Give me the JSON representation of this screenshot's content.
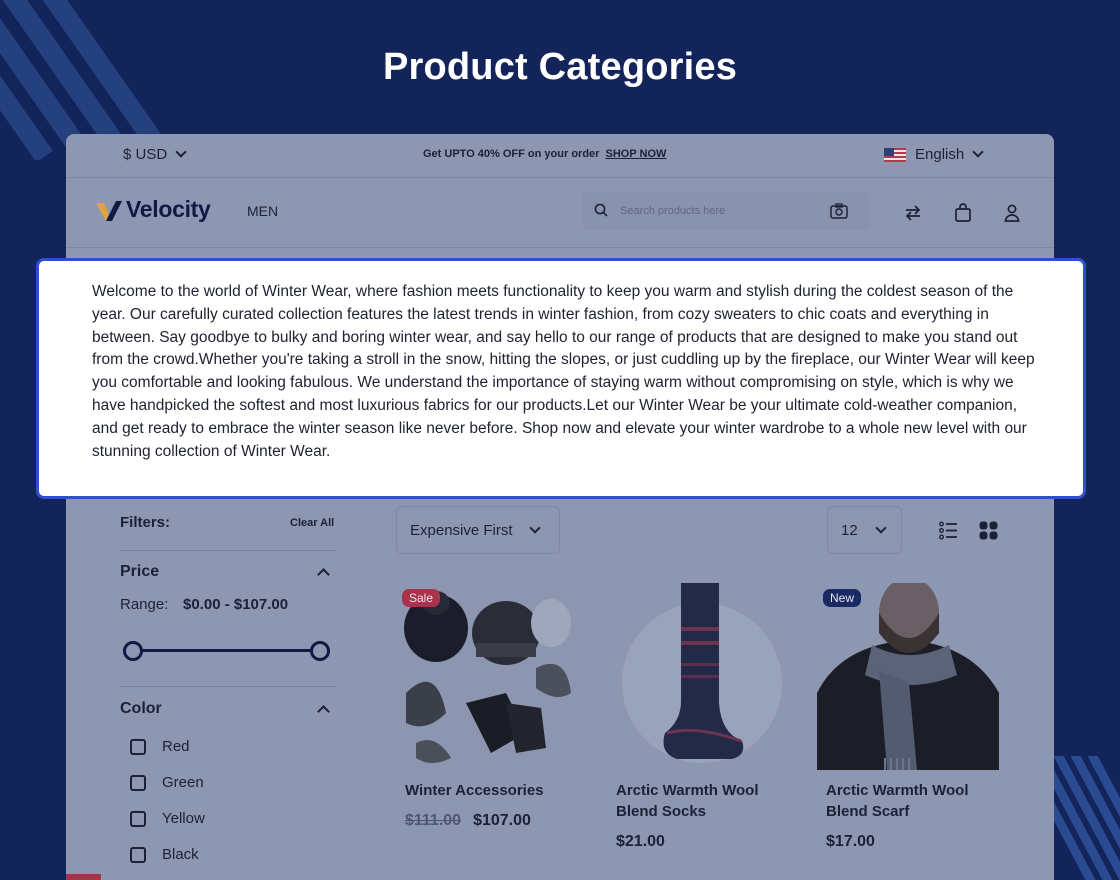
{
  "page_title": "Product Categories",
  "topbar": {
    "currency": "$ USD",
    "promo_text": "Get UPTO 40% OFF on your order",
    "promo_link": "SHOP NOW",
    "language": "English"
  },
  "header": {
    "brand": "Velocity",
    "nav": [
      "MEN"
    ],
    "search_placeholder": "Search products here"
  },
  "description": "Welcome to the world of Winter Wear, where fashion meets functionality to keep you warm and stylish during the coldest season of the year. Our carefully curated collection features the latest trends in winter fashion, from cozy sweaters to chic coats and everything in between. Say goodbye to bulky and boring winter wear, and say hello to our range of products that are designed to make you stand out from the crowd.Whether you're taking a stroll in the snow, hitting the slopes, or just cuddling up by the fireplace, our Winter Wear will keep you comfortable and looking fabulous. We understand the importance of staying warm without compromising on style, which is why we have handpicked the softest and most luxurious fabrics for our products.Let our Winter Wear be your ultimate cold-weather companion, and get ready to embrace the winter season like never before. Shop now and elevate your winter wardrobe to a whole new level with our stunning collection of Winter Wear.",
  "filters": {
    "title": "Filters:",
    "clear_all": "Clear All",
    "price": {
      "title": "Price",
      "range_label": "Range:",
      "range_value": "$0.00 - $107.00"
    },
    "color": {
      "title": "Color",
      "options": [
        "Red",
        "Green",
        "Yellow",
        "Black"
      ]
    }
  },
  "toolbar": {
    "sort": "Expensive First",
    "per_page": "12"
  },
  "products": [
    {
      "name": "Winter Accessories",
      "old_price": "$111.00",
      "price": "$107.00",
      "badge": "Sale"
    },
    {
      "name": "Arctic Warmth Wool Blend Socks",
      "price": "$21.00"
    },
    {
      "name": "Arctic Warmth Wool Blend Scarf",
      "price": "$17.00",
      "badge": "New"
    }
  ],
  "colors": {
    "background": "#13245a",
    "overlay_border": "#2f4fd0",
    "sale_badge": "#a8334a",
    "new_badge": "#1a2b63",
    "brand_accent": "#e2a33a"
  }
}
